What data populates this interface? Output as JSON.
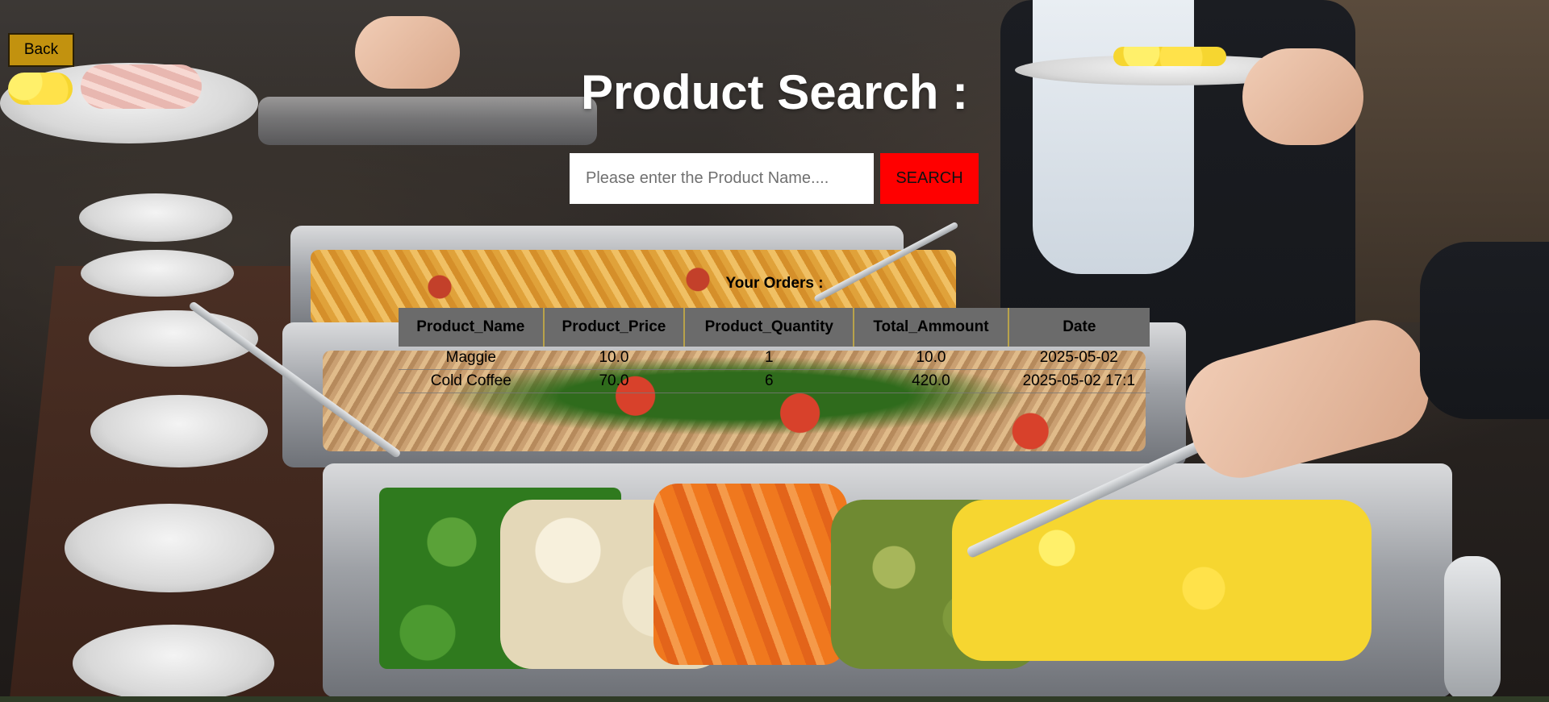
{
  "navigation": {
    "back_label": "Back"
  },
  "header": {
    "title": "Product Search :"
  },
  "search": {
    "placeholder": "Please enter the Product Name....",
    "value": "",
    "button_label": "SEARCH"
  },
  "orders": {
    "heading": "Your Orders :",
    "columns": [
      "Product_Name",
      "Product_Price",
      "Product_Quantity",
      "Total_Ammount",
      "Date"
    ],
    "rows": [
      [
        "Maggie",
        "10.0",
        "1",
        "10.0",
        "2025-05-02"
      ],
      [
        "Cold Coffee",
        "70.0",
        "6",
        "420.0",
        "2025-05-02 17:1"
      ]
    ]
  },
  "colors": {
    "back_button": "#c2920f",
    "search_button": "#ff0000",
    "table_header": "#6b6b6b",
    "title_text": "#ffffff"
  },
  "background": {
    "description_icon": "buffet-food-photo"
  }
}
